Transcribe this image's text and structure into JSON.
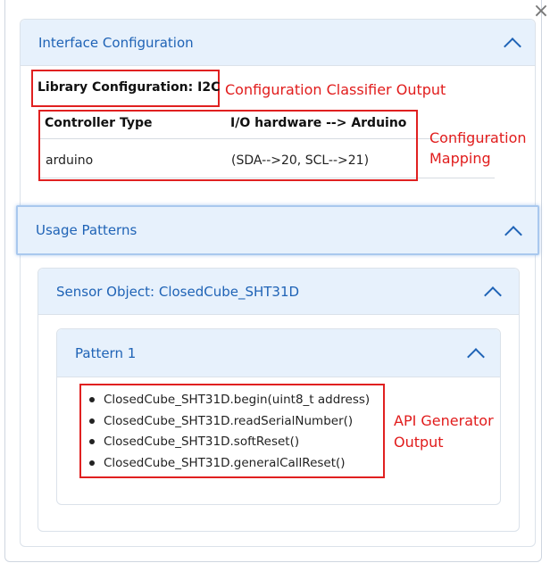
{
  "close_glyph": "×",
  "interface": {
    "header": "Interface Configuration",
    "library_config": "Library Configuration: I2C",
    "table": {
      "headers": [
        "Controller Type",
        "I/O hardware --> Arduino"
      ],
      "rows": [
        [
          "arduino",
          "(SDA-->20, SCL-->21)"
        ]
      ]
    }
  },
  "annotations": {
    "classifier": "Configuration Classifier Output",
    "mapping_line1": "Configuration",
    "mapping_line2": "Mapping",
    "api_line1": "API Generator",
    "api_line2": "Output"
  },
  "usage": {
    "header": "Usage Patterns",
    "sensor": {
      "header": "Sensor Object: ClosedCube_SHT31D",
      "pattern": {
        "header": "Pattern 1",
        "apis": [
          "ClosedCube_SHT31D.begin(uint8_t address)",
          "ClosedCube_SHT31D.readSerialNumber()",
          "ClosedCube_SHT31D.softReset()",
          "ClosedCube_SHT31D.generalCallReset()"
        ]
      }
    }
  },
  "colors": {
    "accent": "#1f63b6",
    "header_bg": "#e7f1fc",
    "annotation_red": "#e11c1c"
  }
}
